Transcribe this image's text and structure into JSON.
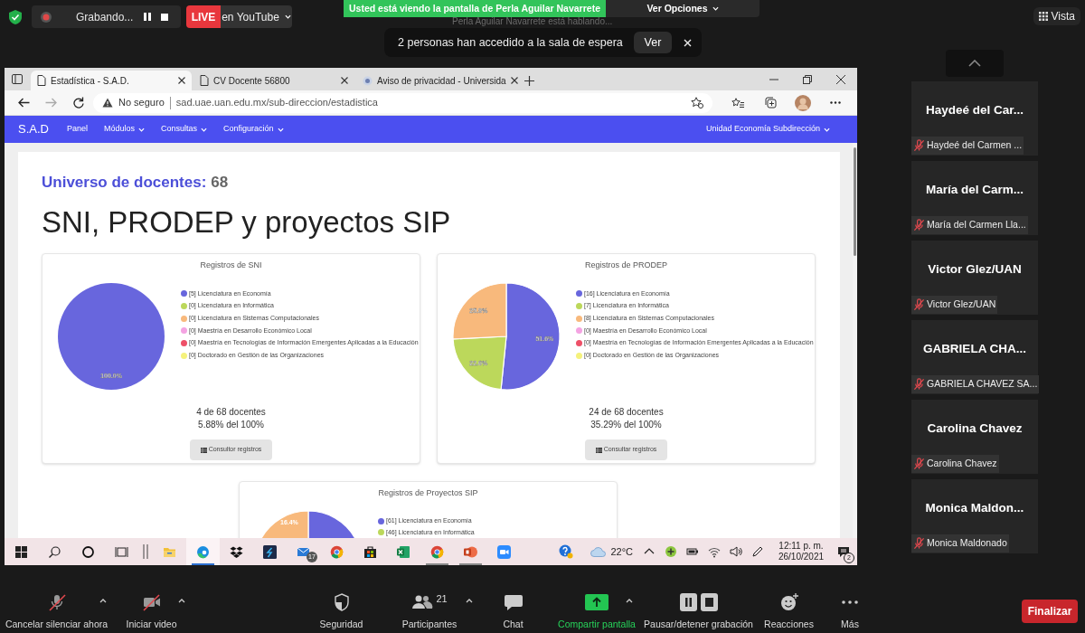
{
  "zoom_top": {
    "recording": "Grabando...",
    "live_badge": "LIVE",
    "live_target": "en YouTube",
    "share_banner": "Usted está viendo la pantalla de Perla Aguilar Navarrete",
    "share_options": "Ver Opciones",
    "speaking": "Perla Aguilar Navarrete está hablando...",
    "notice": "2 personas han accedido a la sala de espera",
    "notice_button": "Ver",
    "view_button": "Vista"
  },
  "browser": {
    "tabs": [
      {
        "title": "Estadística - S.A.D.",
        "kind": "page",
        "selected": true
      },
      {
        "title": "CV Docente 56800",
        "kind": "page",
        "selected": false
      },
      {
        "title": "Aviso de privacidad - Universida",
        "kind": "site",
        "selected": false
      }
    ],
    "security": "No seguro",
    "url": "sad.uae.uan.edu.mx/sub-direccion/estadistica"
  },
  "navbar": {
    "brand": "S.A.D",
    "items": [
      {
        "label": "Panel",
        "dropdown": false
      },
      {
        "label": "Módulos",
        "dropdown": true
      },
      {
        "label": "Consultas",
        "dropdown": true
      },
      {
        "label": "Configuración",
        "dropdown": true
      }
    ],
    "user": "Unidad Economía Subdirección"
  },
  "page": {
    "universe_label": "Universo de docentes:",
    "universe_value": "68",
    "title": "SNI, PRODEP y proyectos SIP",
    "cards": [
      {
        "chart_data": {
          "type": "pie",
          "title": "Registros de SNI",
          "categories": [
            "[5] Licenciatura en Economía",
            "[0] Licenciatura en Informática",
            "[0] Licenciatura en Sistemas Computacionales",
            "[0] Maestría en Desarrollo Económico Local",
            "[0] Maestría en Tecnologías de Información Emergentes Aplicadas a la Educación",
            "[0] Doctorado en Gestión de las Organizaciones"
          ],
          "values": [
            100.0,
            0,
            0,
            0,
            0,
            0
          ],
          "colors": [
            "#6866dd",
            "#bcd85b",
            "#f8b97c",
            "#f4a3e2",
            "#ee5068",
            "#f5f27c"
          ],
          "value_labels": [
            "100.0%",
            null,
            null,
            null,
            null,
            null
          ]
        },
        "stats": [
          "4 de 68 docentes",
          "5.88% del 100%"
        ],
        "button": "Consultor registros"
      },
      {
        "chart_data": {
          "type": "pie",
          "title": "Registros de PRODEP",
          "categories": [
            "[16] Licenciatura en Economía",
            "[7] Licenciatura en Informática",
            "[8] Licenciatura en Sistemas Computacionales",
            "[0] Maestría en Desarrollo Económico Local",
            "[0] Maestría en Tecnologías de Información Emergentes Aplicadas a la Educación",
            "[0] Doctorado en Gestión de las Organizaciones"
          ],
          "values": [
            51.6,
            22.6,
            25.8,
            0,
            0,
            0
          ],
          "colors": [
            "#6866dd",
            "#bcd85b",
            "#f8b97c",
            "#f4a3e2",
            "#ee5068",
            "#f5f27c"
          ],
          "value_labels": [
            "51.6%",
            "22.6%",
            "25.8%",
            null,
            null,
            null
          ]
        },
        "stats": [
          "24 de 68 docentes",
          "35.29% del 100%"
        ],
        "button": "Consultar registros"
      }
    ],
    "partial_card": {
      "title": "Registros de Proyectos SIP",
      "slice_label": "16.4%",
      "legend": [
        {
          "label": "[61] Licenciatura en Economía",
          "color": "#6866dd"
        },
        {
          "label": "[46] Licenciatura en Informática",
          "color": "#bcd85b"
        }
      ]
    }
  },
  "taskbar": {
    "apps": [
      {
        "kind": "start",
        "selected": false,
        "open": false
      },
      {
        "kind": "search",
        "selected": false,
        "open": false
      },
      {
        "kind": "cortana",
        "selected": false,
        "open": false
      },
      {
        "kind": "taskview",
        "selected": false,
        "open": false
      },
      {
        "kind": "explorer",
        "selected": false,
        "open": false
      },
      {
        "kind": "edge",
        "selected": true,
        "open": true
      },
      {
        "kind": "dropbox",
        "selected": false,
        "open": false
      },
      {
        "kind": "app",
        "selected": false,
        "open": false
      },
      {
        "kind": "mail",
        "selected": false,
        "open": false,
        "badge": "17"
      },
      {
        "kind": "chrome",
        "selected": false,
        "open": false
      },
      {
        "kind": "store",
        "selected": false,
        "open": false
      },
      {
        "kind": "excel",
        "selected": false,
        "open": false
      },
      {
        "kind": "chrome",
        "selected": false,
        "open": true
      },
      {
        "kind": "powerpoint",
        "selected": false,
        "open": true
      },
      {
        "kind": "zoom",
        "selected": false,
        "open": false
      }
    ],
    "temperature": "22°C",
    "time": "12:11 p. m.",
    "date": "26/10/2021",
    "notifications": "2"
  },
  "participants": [
    {
      "tile_name": "Haydeé del Car...",
      "name": "Haydeé del Carmen ...",
      "muted": true
    },
    {
      "tile_name": "María del Carm...",
      "name": "María del Carmen Lla...",
      "muted": true
    },
    {
      "tile_name": "Victor Glez/UAN",
      "name": "Victor Glez/UAN",
      "muted": true
    },
    {
      "tile_name": "GABRIELA CHA...",
      "name": "GABRIELA CHAVEZ SA...",
      "muted": true
    },
    {
      "tile_name": "Carolina Chavez",
      "name": "Carolina Chavez",
      "muted": true
    },
    {
      "tile_name": "Monica Maldon...",
      "name": "Monica Maldonado",
      "muted": true
    }
  ],
  "toolbar": {
    "items": [
      {
        "kind": "mic",
        "label": "Cancelar silenciar ahora",
        "muted": true,
        "caret": true
      },
      {
        "kind": "video",
        "label": "Iniciar video",
        "muted": true,
        "caret": true
      },
      {
        "kind": "security",
        "label": "Seguridad",
        "caret": false
      },
      {
        "kind": "participants",
        "label": "Participantes",
        "count": "21",
        "caret": true
      },
      {
        "kind": "chat",
        "label": "Chat",
        "caret": false
      },
      {
        "kind": "share",
        "label": "Compartir pantalla",
        "active": true,
        "caret": true
      },
      {
        "kind": "record",
        "label": "Pausar/detener grabación",
        "caret": false
      },
      {
        "kind": "reactions",
        "label": "Reacciones",
        "caret": false
      },
      {
        "kind": "more",
        "label": "Más",
        "caret": false
      }
    ],
    "end_button": "Finalizar"
  }
}
